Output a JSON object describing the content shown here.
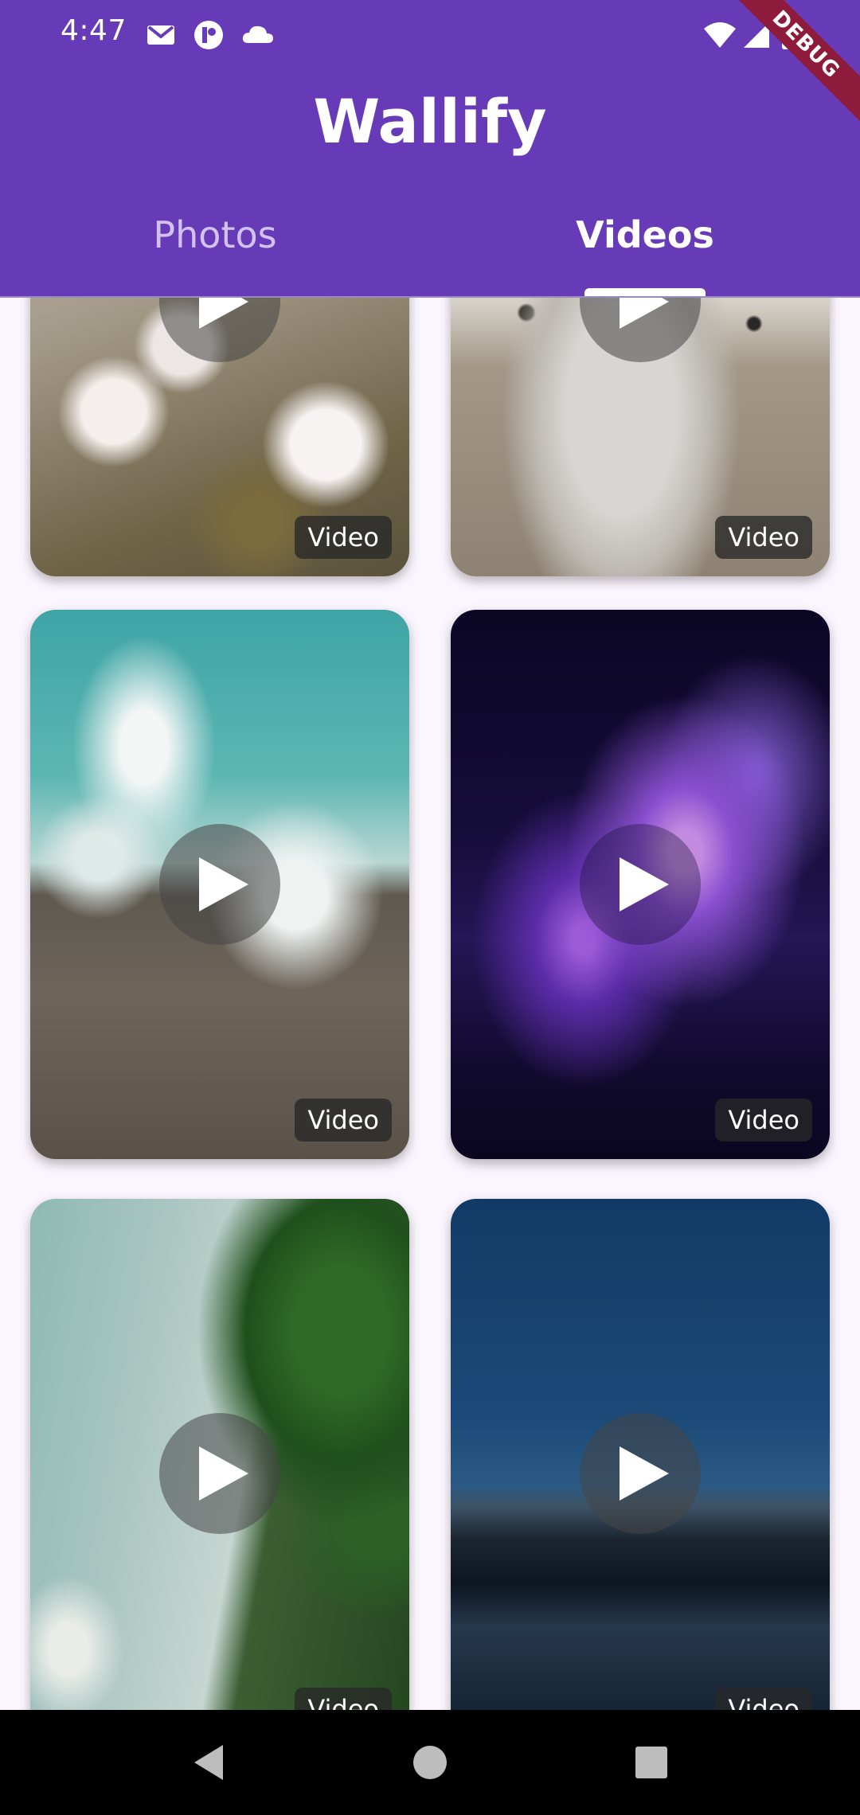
{
  "status_bar": {
    "time": "4:47"
  },
  "app": {
    "title": "Wallify",
    "debug_banner": "DEBUG"
  },
  "tabs": [
    {
      "label": "Photos",
      "active": false
    },
    {
      "label": "Videos",
      "active": true
    }
  ],
  "videos": [
    {
      "theme": "cherry blossom",
      "badge": "Video"
    },
    {
      "theme": "snow leopard paw",
      "badge": "Video"
    },
    {
      "theme": "ocean waves on rocks",
      "badge": "Video"
    },
    {
      "theme": "purple particles",
      "badge": "Video"
    },
    {
      "theme": "beach and forest aerial",
      "badge": "Video"
    },
    {
      "theme": "night mountain lake",
      "badge": "Video"
    }
  ],
  "colors": {
    "primary": "#673ab7",
    "background": "#fbf5fd",
    "debug": "#8e1b3b"
  }
}
